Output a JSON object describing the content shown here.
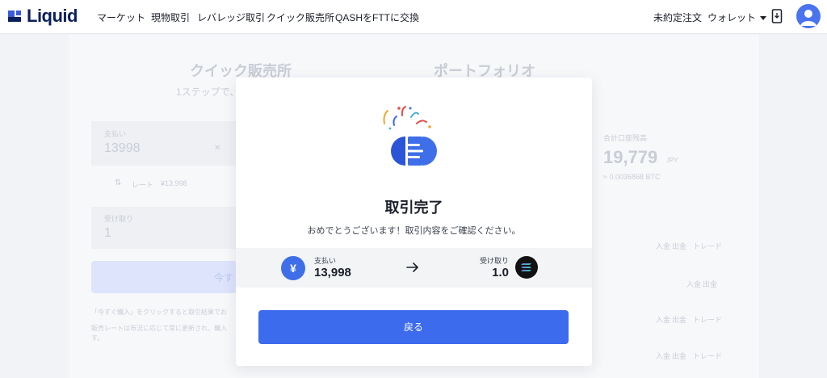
{
  "brand": {
    "name": "Liquid"
  },
  "nav": {
    "items": [
      {
        "label": "マーケット"
      },
      {
        "label": "現物取引"
      },
      {
        "label": "レバレッジ取引"
      },
      {
        "label": "クイック販売所"
      },
      {
        "label": "QASHをFTTに交換"
      }
    ],
    "open_orders": "未約定注文",
    "wallet": "ウォレット"
  },
  "background": {
    "left_title": "クイック販売所",
    "left_subtitle": "1ステップで、",
    "pay_label": "支払い",
    "pay_value": "13998",
    "rate_label": "レート",
    "rate_value": "¥13,998",
    "receive_label": "受け取り",
    "receive_value": "1",
    "buy_button": "今す",
    "note1": "「今すぐ購入」をクリックすると取引結果でお",
    "note2": "販売レートは市況に応じて常に更新され、購入",
    "note3": "す。",
    "right_title": "ポートフォリオ",
    "balance_label": "合計口座残高",
    "balance_value": "19,779",
    "balance_unit": "JPY",
    "balance_btc": "≈ 0.0036868 BTC",
    "row_actions": [
      {
        "deposit": "入金",
        "withdraw": "出金",
        "trade": "トレード"
      },
      {
        "deposit": "入金",
        "withdraw": "出金",
        "trade": ""
      },
      {
        "deposit": "入金",
        "withdraw": "出金",
        "trade": "トレード"
      },
      {
        "deposit": "入金",
        "withdraw": "出金",
        "trade": "トレード"
      }
    ]
  },
  "modal": {
    "title": "取引完了",
    "subtitle": "おめでとうございます！取引内容をご確認ください。",
    "pay": {
      "label": "支払い",
      "value": "13,998",
      "currency_symbol": "¥"
    },
    "receive": {
      "label": "受け取り",
      "value": "1.0"
    },
    "back_button": "戻る"
  },
  "colors": {
    "accent": "#3d6bee",
    "brand": "#0a1f5c",
    "yen_badge": "#3f6fe8"
  },
  "icons": {
    "yen": "yen-icon",
    "arrow": "arrow-right-icon",
    "sol": "solana-icon",
    "phone": "phone-icon",
    "avatar": "user-icon"
  }
}
